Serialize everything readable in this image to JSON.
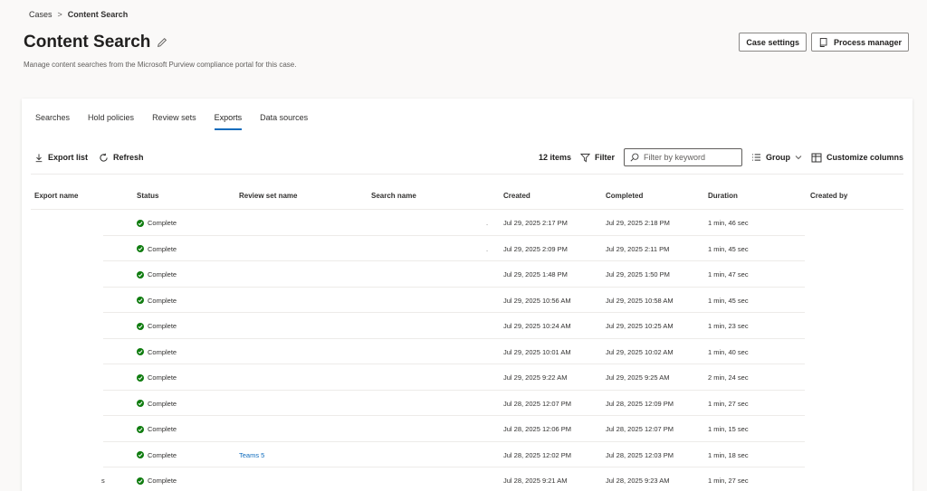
{
  "breadcrumb": {
    "root": "Cases",
    "separator": ">",
    "current": "Content Search"
  },
  "page": {
    "title": "Content Search",
    "subtitle": "Manage content searches from the Microsoft Purview compliance portal for this case."
  },
  "top_actions": {
    "case_settings": "Case settings",
    "process_manager": "Process manager"
  },
  "tabs": [
    {
      "label": "Searches",
      "active": false
    },
    {
      "label": "Hold policies",
      "active": false
    },
    {
      "label": "Review sets",
      "active": false
    },
    {
      "label": "Exports",
      "active": true
    },
    {
      "label": "Data sources",
      "active": false
    }
  ],
  "toolbar": {
    "export_list": "Export list",
    "refresh": "Refresh",
    "item_count": "12 items",
    "filter": "Filter",
    "filter_placeholder": "Filter by keyword",
    "group": "Group",
    "customize_columns": "Customize columns"
  },
  "columns": {
    "export_name": "Export name",
    "status": "Status",
    "review_set_name": "Review set name",
    "search_name": "Search name",
    "created": "Created",
    "completed": "Completed",
    "duration": "Duration",
    "created_by": "Created by"
  },
  "rows": [
    {
      "export_name": "",
      "status": "Complete",
      "review_set": "",
      "search_name": ".",
      "created": "Jul 29, 2025 2:17 PM",
      "completed": "Jul 29, 2025 2:18 PM",
      "duration": "1 min, 46 sec",
      "created_by": ""
    },
    {
      "export_name": "",
      "status": "Complete",
      "review_set": "",
      "search_name": ".",
      "created": "Jul 29, 2025 2:09 PM",
      "completed": "Jul 29, 2025 2:11 PM",
      "duration": "1 min, 45 sec",
      "created_by": ""
    },
    {
      "export_name": "",
      "status": "Complete",
      "review_set": "",
      "search_name": "",
      "created": "Jul 29, 2025 1:48 PM",
      "completed": "Jul 29, 2025 1:50 PM",
      "duration": "1 min, 47 sec",
      "created_by": ""
    },
    {
      "export_name": "",
      "status": "Complete",
      "review_set": "",
      "search_name": "",
      "created": "Jul 29, 2025 10:56 AM",
      "completed": "Jul 29, 2025 10:58 AM",
      "duration": "1 min, 45 sec",
      "created_by": ""
    },
    {
      "export_name": "",
      "status": "Complete",
      "review_set": "",
      "search_name": "",
      "created": "Jul 29, 2025 10:24 AM",
      "completed": "Jul 29, 2025 10:25 AM",
      "duration": "1 min, 23 sec",
      "created_by": ""
    },
    {
      "export_name": "",
      "status": "Complete",
      "review_set": "",
      "search_name": "",
      "created": "Jul 29, 2025 10:01 AM",
      "completed": "Jul 29, 2025 10:02 AM",
      "duration": "1 min, 40 sec",
      "created_by": ""
    },
    {
      "export_name": "",
      "status": "Complete",
      "review_set": "",
      "search_name": "",
      "created": "Jul 29, 2025 9:22 AM",
      "completed": "Jul 29, 2025 9:25 AM",
      "duration": "2 min, 24 sec",
      "created_by": ""
    },
    {
      "export_name": "",
      "status": "Complete",
      "review_set": "",
      "search_name": "",
      "created": "Jul 28, 2025 12:07 PM",
      "completed": "Jul 28, 2025 12:09 PM",
      "duration": "1 min, 27 sec",
      "created_by": ""
    },
    {
      "export_name": "",
      "status": "Complete",
      "review_set": "",
      "search_name": "",
      "created": "Jul 28, 2025 12:06 PM",
      "completed": "Jul 28, 2025 12:07 PM",
      "duration": "1 min, 15 sec",
      "created_by": ""
    },
    {
      "export_name": "",
      "status": "Complete",
      "review_set": "Teams 5",
      "search_name": "",
      "created": "Jul 28, 2025 12:02 PM",
      "completed": "Jul 28, 2025 12:03 PM",
      "duration": "1 min, 18 sec",
      "created_by": ""
    },
    {
      "export_name": "s",
      "status": "Complete",
      "review_set": "",
      "search_name": "",
      "created": "Jul 28, 2025 9:21 AM",
      "completed": "Jul 28, 2025 9:23 AM",
      "duration": "1 min, 27 sec",
      "created_by": ""
    }
  ],
  "colors": {
    "accent": "#0f6cbd",
    "success": "#107c10"
  }
}
